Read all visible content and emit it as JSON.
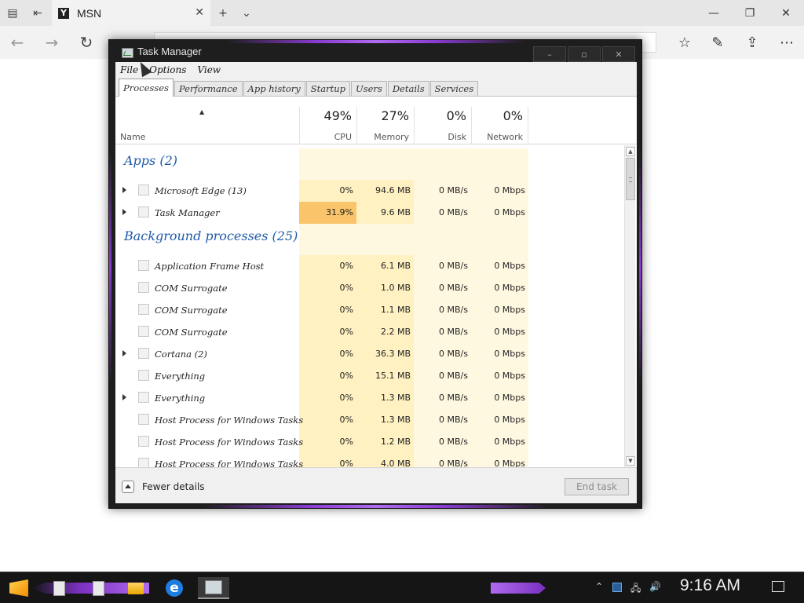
{
  "browser": {
    "tab_title": "MSN",
    "favicon_letter": "Y",
    "icons": {
      "tab_actions": "tab-set-aside-icon",
      "back_tab": "tab-back-icon",
      "new_tab": "plus-icon",
      "tab_list": "chevron-down-icon",
      "back": "back-arrow-icon",
      "forward": "forward-arrow-icon",
      "refresh": "refresh-icon",
      "favorites": "favorites-icon",
      "notes": "pen-icon",
      "share": "share-icon",
      "more": "more-icon"
    }
  },
  "task_manager": {
    "title": "Task Manager",
    "menu": [
      "File",
      "Options",
      "View"
    ],
    "tabs": [
      "Processes",
      "Performance",
      "App history",
      "Startup",
      "Users",
      "Details",
      "Services"
    ],
    "active_tab": "Processes",
    "columns": {
      "name": "Name",
      "cpu": {
        "pct": "49%",
        "label": "CPU"
      },
      "memory": {
        "pct": "27%",
        "label": "Memory"
      },
      "disk": {
        "pct": "0%",
        "label": "Disk"
      },
      "network": {
        "pct": "0%",
        "label": "Network"
      }
    },
    "groups": [
      {
        "title": "Apps (2)",
        "rows": [
          {
            "name": "Microsoft Edge (13)",
            "expandable": true,
            "cpu": "0%",
            "memory": "94.6 MB",
            "disk": "0 MB/s",
            "network": "0 Mbps"
          },
          {
            "name": "Task Manager",
            "expandable": true,
            "cpu": "31.9%",
            "memory": "9.6 MB",
            "disk": "0 MB/s",
            "network": "0 Mbps",
            "cpu_highlight": true
          }
        ]
      },
      {
        "title": "Background processes (25)",
        "rows": [
          {
            "name": "Application Frame Host",
            "expandable": false,
            "cpu": "0%",
            "memory": "6.1 MB",
            "disk": "0 MB/s",
            "network": "0 Mbps"
          },
          {
            "name": "COM Surrogate",
            "expandable": false,
            "cpu": "0%",
            "memory": "1.0 MB",
            "disk": "0 MB/s",
            "network": "0 Mbps"
          },
          {
            "name": "COM Surrogate",
            "expandable": false,
            "cpu": "0%",
            "memory": "1.1 MB",
            "disk": "0 MB/s",
            "network": "0 Mbps"
          },
          {
            "name": "COM Surrogate",
            "expandable": false,
            "cpu": "0%",
            "memory": "2.2 MB",
            "disk": "0 MB/s",
            "network": "0 Mbps"
          },
          {
            "name": "Cortana (2)",
            "expandable": true,
            "cpu": "0%",
            "memory": "36.3 MB",
            "disk": "0 MB/s",
            "network": "0 Mbps"
          },
          {
            "name": "Everything",
            "expandable": false,
            "cpu": "0%",
            "memory": "15.1 MB",
            "disk": "0 MB/s",
            "network": "0 Mbps"
          },
          {
            "name": "Everything",
            "expandable": true,
            "cpu": "0%",
            "memory": "1.3 MB",
            "disk": "0 MB/s",
            "network": "0 Mbps"
          },
          {
            "name": "Host Process for Windows Tasks",
            "expandable": false,
            "cpu": "0%",
            "memory": "1.3 MB",
            "disk": "0 MB/s",
            "network": "0 Mbps"
          },
          {
            "name": "Host Process for Windows Tasks",
            "expandable": false,
            "cpu": "0%",
            "memory": "1.2 MB",
            "disk": "0 MB/s",
            "network": "0 Mbps"
          },
          {
            "name": "Host Process for Windows Tasks",
            "expandable": false,
            "cpu": "0%",
            "memory": "4.0 MB",
            "disk": "0 MB/s",
            "network": "0 Mbps"
          }
        ]
      }
    ],
    "footer": {
      "fewer_details": "Fewer details",
      "end_task": "End task"
    },
    "colors": {
      "cell_light": "#fff8e1",
      "cell_mid": "#fff1c2",
      "cell_strong": "#f9c46a",
      "group_title": "#1e5aa8"
    }
  },
  "taskbar": {
    "clock": "9:16 AM",
    "icons": [
      "start-icon",
      "document-icon",
      "document-icon",
      "file-explorer-icon",
      "edge-icon",
      "task-manager-icon"
    ],
    "tray_icons": [
      "tray-chevron-icon",
      "tray-app-icon",
      "network-icon",
      "volume-icon",
      "notification-icon"
    ]
  }
}
